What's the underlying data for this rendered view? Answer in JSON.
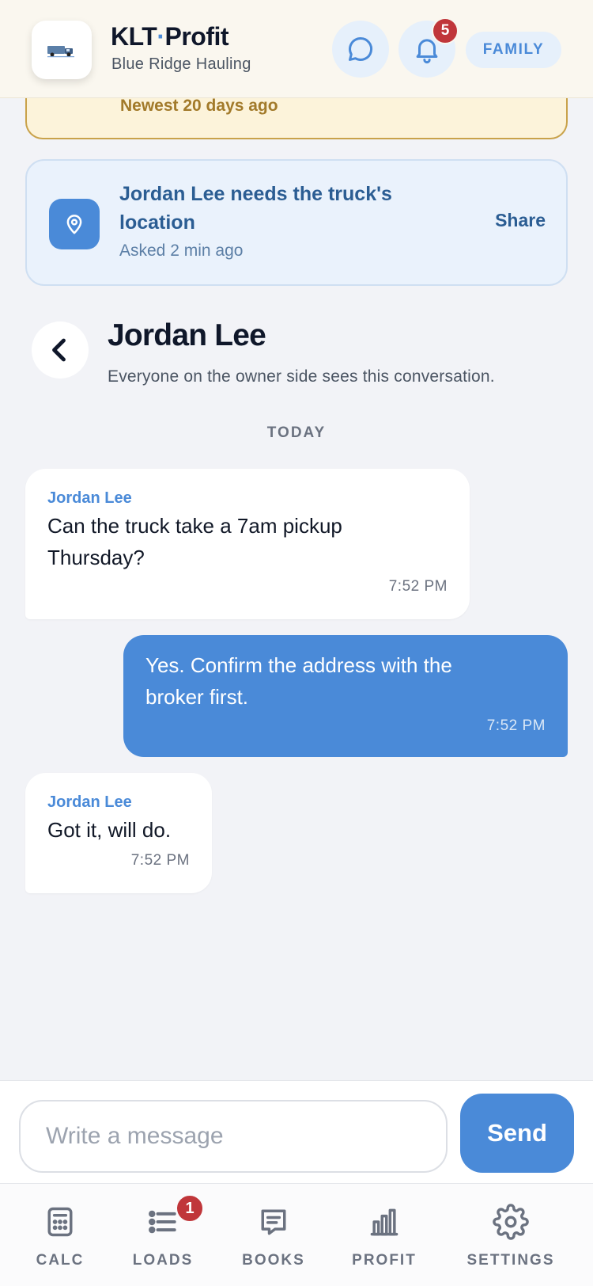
{
  "header": {
    "brand_name_part1": "KLT",
    "brand_name_dot": "·",
    "brand_name_part2": "Profit",
    "company": "Blue Ridge Hauling",
    "notification_count": "5",
    "role_pill": "FAMILY",
    "icons": [
      "truck-logo-icon",
      "chat-bubble-icon",
      "bell-icon"
    ]
  },
  "alert": {
    "text": "Newest 20 days ago"
  },
  "location_request": {
    "title": "Jordan Lee needs the truck's location",
    "asked": "Asked 2 min ago",
    "action": "Share",
    "icon": "location-pin-icon"
  },
  "conversation": {
    "title": "Jordan Lee",
    "subtitle": "Everyone on the owner side sees this conversation.",
    "day_label": "TODAY",
    "messages": [
      {
        "direction": "incoming",
        "sender": "Jordan Lee",
        "lines": [
          "Can the truck take a 7am pickup",
          "Thursday?"
        ],
        "time": "7:52 PM"
      },
      {
        "direction": "outgoing",
        "lines": [
          "Yes. Confirm the address with the",
          "broker first."
        ],
        "time": "7:52 PM"
      },
      {
        "direction": "incoming",
        "sender": "Jordan Lee",
        "lines": [
          "Got it, will do."
        ],
        "time": "7:52 PM"
      }
    ]
  },
  "composer": {
    "placeholder": "Write a message",
    "value": "",
    "send_label": "Send"
  },
  "nav": {
    "items": [
      {
        "label": "CALC",
        "icon": "calculator-icon"
      },
      {
        "label": "LOADS",
        "icon": "list-icon",
        "badge": "1"
      },
      {
        "label": "BOOKS",
        "icon": "notebook-icon"
      },
      {
        "label": "PROFIT",
        "icon": "bar-chart-icon"
      },
      {
        "label": "SETTINGS",
        "icon": "gear-icon"
      }
    ]
  },
  "colors": {
    "accent": "#4a8ad8",
    "badge": "#c0363a",
    "alert_bg": "#fcf3da",
    "alert_text": "#a27a2a",
    "request_text": "#2b5d93"
  }
}
